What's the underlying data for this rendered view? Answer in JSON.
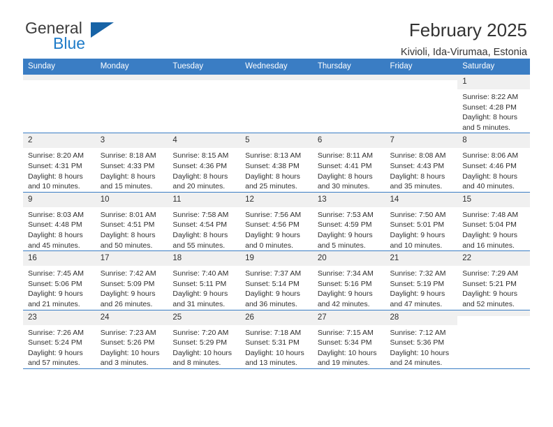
{
  "brand": {
    "line1": "General",
    "line2": "Blue",
    "logo_icon": "triangle-logo-icon"
  },
  "header": {
    "title": "February 2025",
    "location": "Kivioli, Ida-Virumaa, Estonia"
  },
  "calendar": {
    "weekday_headers": [
      "Sunday",
      "Monday",
      "Tuesday",
      "Wednesday",
      "Thursday",
      "Friday",
      "Saturday"
    ],
    "accent_color": "#3a7dc4",
    "weeks": [
      [
        {
          "day": "",
          "empty": true
        },
        {
          "day": "",
          "empty": true
        },
        {
          "day": "",
          "empty": true
        },
        {
          "day": "",
          "empty": true
        },
        {
          "day": "",
          "empty": true
        },
        {
          "day": "",
          "empty": true
        },
        {
          "day": "1",
          "sunrise": "Sunrise: 8:22 AM",
          "sunset": "Sunset: 4:28 PM",
          "daylight1": "Daylight: 8 hours",
          "daylight2": "and 5 minutes."
        }
      ],
      [
        {
          "day": "2",
          "sunrise": "Sunrise: 8:20 AM",
          "sunset": "Sunset: 4:31 PM",
          "daylight1": "Daylight: 8 hours",
          "daylight2": "and 10 minutes."
        },
        {
          "day": "3",
          "sunrise": "Sunrise: 8:18 AM",
          "sunset": "Sunset: 4:33 PM",
          "daylight1": "Daylight: 8 hours",
          "daylight2": "and 15 minutes."
        },
        {
          "day": "4",
          "sunrise": "Sunrise: 8:15 AM",
          "sunset": "Sunset: 4:36 PM",
          "daylight1": "Daylight: 8 hours",
          "daylight2": "and 20 minutes."
        },
        {
          "day": "5",
          "sunrise": "Sunrise: 8:13 AM",
          "sunset": "Sunset: 4:38 PM",
          "daylight1": "Daylight: 8 hours",
          "daylight2": "and 25 minutes."
        },
        {
          "day": "6",
          "sunrise": "Sunrise: 8:11 AM",
          "sunset": "Sunset: 4:41 PM",
          "daylight1": "Daylight: 8 hours",
          "daylight2": "and 30 minutes."
        },
        {
          "day": "7",
          "sunrise": "Sunrise: 8:08 AM",
          "sunset": "Sunset: 4:43 PM",
          "daylight1": "Daylight: 8 hours",
          "daylight2": "and 35 minutes."
        },
        {
          "day": "8",
          "sunrise": "Sunrise: 8:06 AM",
          "sunset": "Sunset: 4:46 PM",
          "daylight1": "Daylight: 8 hours",
          "daylight2": "and 40 minutes."
        }
      ],
      [
        {
          "day": "9",
          "sunrise": "Sunrise: 8:03 AM",
          "sunset": "Sunset: 4:48 PM",
          "daylight1": "Daylight: 8 hours",
          "daylight2": "and 45 minutes."
        },
        {
          "day": "10",
          "sunrise": "Sunrise: 8:01 AM",
          "sunset": "Sunset: 4:51 PM",
          "daylight1": "Daylight: 8 hours",
          "daylight2": "and 50 minutes."
        },
        {
          "day": "11",
          "sunrise": "Sunrise: 7:58 AM",
          "sunset": "Sunset: 4:54 PM",
          "daylight1": "Daylight: 8 hours",
          "daylight2": "and 55 minutes."
        },
        {
          "day": "12",
          "sunrise": "Sunrise: 7:56 AM",
          "sunset": "Sunset: 4:56 PM",
          "daylight1": "Daylight: 9 hours",
          "daylight2": "and 0 minutes."
        },
        {
          "day": "13",
          "sunrise": "Sunrise: 7:53 AM",
          "sunset": "Sunset: 4:59 PM",
          "daylight1": "Daylight: 9 hours",
          "daylight2": "and 5 minutes."
        },
        {
          "day": "14",
          "sunrise": "Sunrise: 7:50 AM",
          "sunset": "Sunset: 5:01 PM",
          "daylight1": "Daylight: 9 hours",
          "daylight2": "and 10 minutes."
        },
        {
          "day": "15",
          "sunrise": "Sunrise: 7:48 AM",
          "sunset": "Sunset: 5:04 PM",
          "daylight1": "Daylight: 9 hours",
          "daylight2": "and 16 minutes."
        }
      ],
      [
        {
          "day": "16",
          "sunrise": "Sunrise: 7:45 AM",
          "sunset": "Sunset: 5:06 PM",
          "daylight1": "Daylight: 9 hours",
          "daylight2": "and 21 minutes."
        },
        {
          "day": "17",
          "sunrise": "Sunrise: 7:42 AM",
          "sunset": "Sunset: 5:09 PM",
          "daylight1": "Daylight: 9 hours",
          "daylight2": "and 26 minutes."
        },
        {
          "day": "18",
          "sunrise": "Sunrise: 7:40 AM",
          "sunset": "Sunset: 5:11 PM",
          "daylight1": "Daylight: 9 hours",
          "daylight2": "and 31 minutes."
        },
        {
          "day": "19",
          "sunrise": "Sunrise: 7:37 AM",
          "sunset": "Sunset: 5:14 PM",
          "daylight1": "Daylight: 9 hours",
          "daylight2": "and 36 minutes."
        },
        {
          "day": "20",
          "sunrise": "Sunrise: 7:34 AM",
          "sunset": "Sunset: 5:16 PM",
          "daylight1": "Daylight: 9 hours",
          "daylight2": "and 42 minutes."
        },
        {
          "day": "21",
          "sunrise": "Sunrise: 7:32 AM",
          "sunset": "Sunset: 5:19 PM",
          "daylight1": "Daylight: 9 hours",
          "daylight2": "and 47 minutes."
        },
        {
          "day": "22",
          "sunrise": "Sunrise: 7:29 AM",
          "sunset": "Sunset: 5:21 PM",
          "daylight1": "Daylight: 9 hours",
          "daylight2": "and 52 minutes."
        }
      ],
      [
        {
          "day": "23",
          "sunrise": "Sunrise: 7:26 AM",
          "sunset": "Sunset: 5:24 PM",
          "daylight1": "Daylight: 9 hours",
          "daylight2": "and 57 minutes."
        },
        {
          "day": "24",
          "sunrise": "Sunrise: 7:23 AM",
          "sunset": "Sunset: 5:26 PM",
          "daylight1": "Daylight: 10 hours",
          "daylight2": "and 3 minutes."
        },
        {
          "day": "25",
          "sunrise": "Sunrise: 7:20 AM",
          "sunset": "Sunset: 5:29 PM",
          "daylight1": "Daylight: 10 hours",
          "daylight2": "and 8 minutes."
        },
        {
          "day": "26",
          "sunrise": "Sunrise: 7:18 AM",
          "sunset": "Sunset: 5:31 PM",
          "daylight1": "Daylight: 10 hours",
          "daylight2": "and 13 minutes."
        },
        {
          "day": "27",
          "sunrise": "Sunrise: 7:15 AM",
          "sunset": "Sunset: 5:34 PM",
          "daylight1": "Daylight: 10 hours",
          "daylight2": "and 19 minutes."
        },
        {
          "day": "28",
          "sunrise": "Sunrise: 7:12 AM",
          "sunset": "Sunset: 5:36 PM",
          "daylight1": "Daylight: 10 hours",
          "daylight2": "and 24 minutes."
        },
        {
          "day": "",
          "empty": true
        }
      ]
    ]
  }
}
